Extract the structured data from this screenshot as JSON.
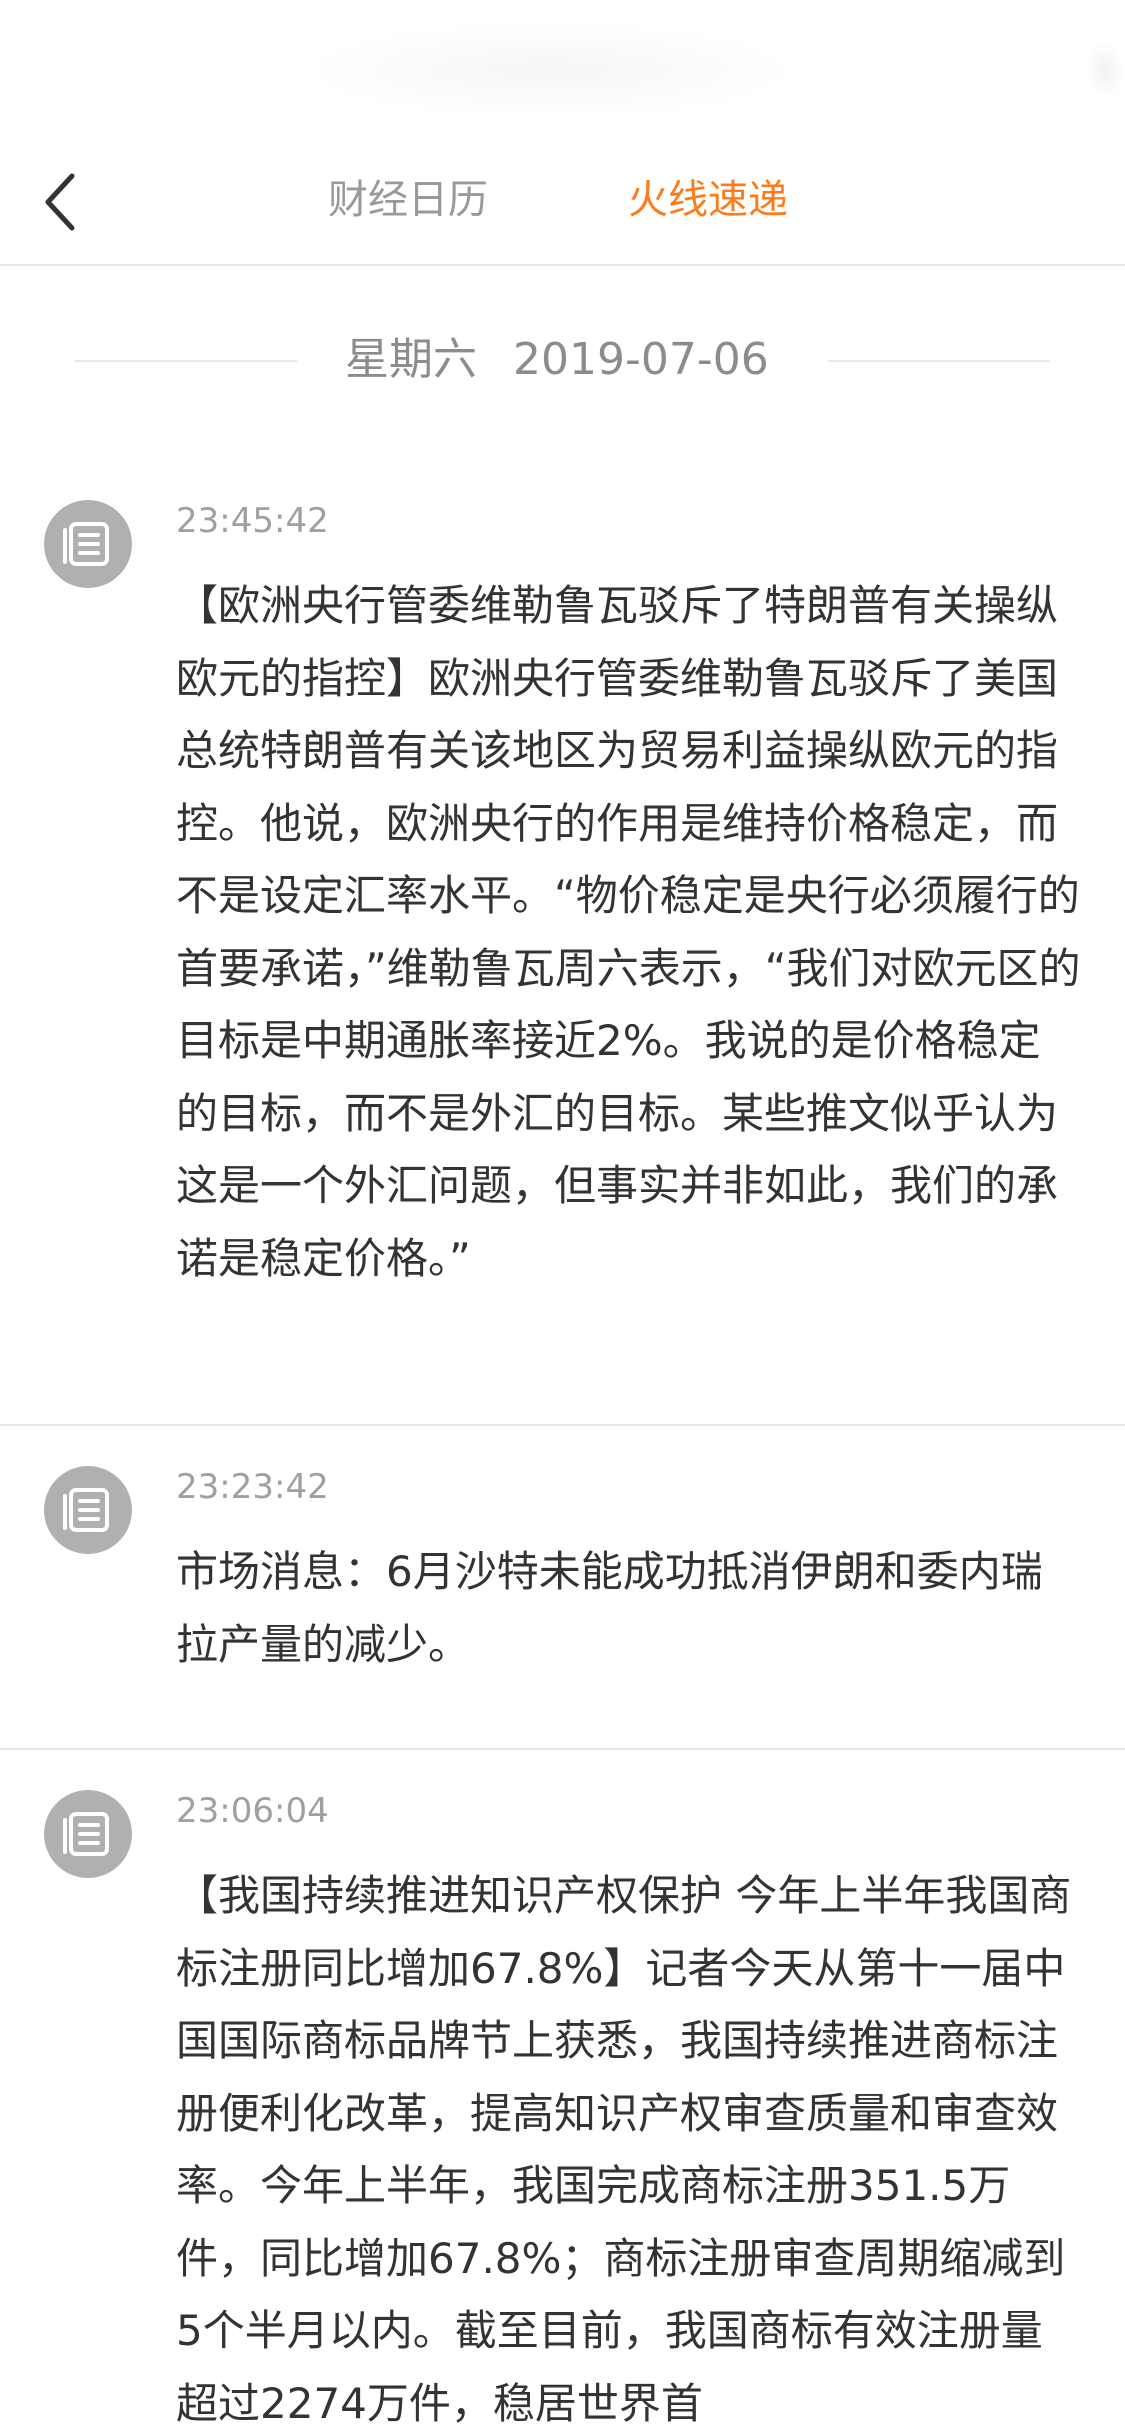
{
  "nav": {
    "tabs": [
      {
        "label": "财经日历",
        "active": false
      },
      {
        "label": "火线速递",
        "active": true
      }
    ],
    "active_color": "#ff7b1a",
    "inactive_color": "#999999",
    "back_icon": "chevron-left-icon"
  },
  "date_header": {
    "weekday": "星期六",
    "date": "2019-07-06"
  },
  "feed": [
    {
      "time": "23:45:42",
      "icon": "news-list-icon",
      "text": "【欧洲央行管委维勒鲁瓦驳斥了特朗普有关操纵欧元的指控】欧洲央行管委维勒鲁瓦驳斥了美国总统特朗普有关该地区为贸易利益操纵欧元的指控。他说，欧洲央行的作用是维持价格稳定，而不是设定汇率水平。“物价稳定是央行必须履行的首要承诺，”维勒鲁瓦周六表示，“我们对欧元区的目标是中期通胀率接近2%。我说的是价格稳定的目标，而不是外汇的目标。某些推文似乎认为这是一个外汇问题，但事实并非如此，我们的承诺是稳定价格。”"
    },
    {
      "time": "23:23:42",
      "icon": "news-list-icon",
      "text": "市场消息：6月沙特未能成功抵消伊朗和委内瑞拉产量的减少。"
    },
    {
      "time": "23:06:04",
      "icon": "news-list-icon",
      "text": "【我国持续推进知识产权保护 今年上半年我国商标注册同比增加67.8%】记者今天从第十一届中国国际商标品牌节上获悉，我国持续推进商标注册便利化改革，提高知识产权审查质量和审查效率。今年上半年，我国完成商标注册351.5万件，同比增加67.8%；商标注册审查周期缩减到5个半月以内。截至目前，我国商标有效注册量超过2274万件，稳居世界首"
    }
  ]
}
